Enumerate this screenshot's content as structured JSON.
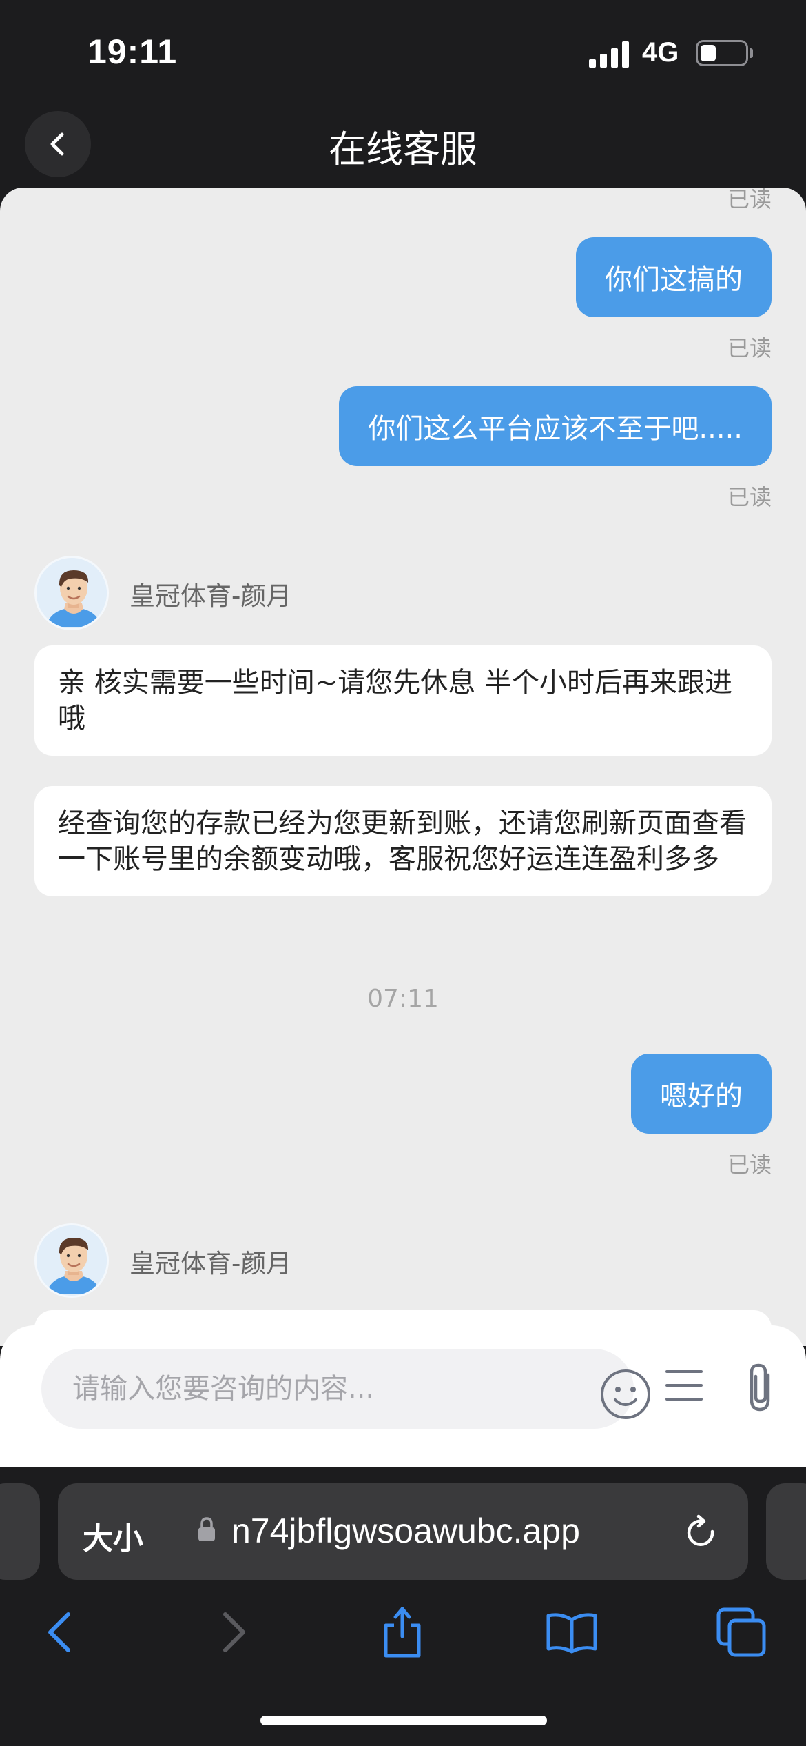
{
  "status_bar": {
    "time": "19:11",
    "network": "4G",
    "battery_level": 0.35
  },
  "nav": {
    "title": "在线客服"
  },
  "messages": {
    "read_label": "已读",
    "out_1": "你们这搞的",
    "out_2": "你们这么平台应该不至于吧.....",
    "agent_name": "皇冠体育-颜月",
    "in_1": "亲 核实需要一些时间~请您先休息 半个小时后再来跟进哦",
    "in_2": "经查询您的存款已经为您更新到账，还请您刷新页面查看一下账号里的余额变动哦，客服祝您好运连连盈利多多",
    "timestamp": "07:11",
    "out_3": "嗯好的"
  },
  "input": {
    "placeholder": "请输入您要咨询的内容..."
  },
  "browser": {
    "text_size_label": "大小",
    "url": "n74jbflgwsoawubc.app"
  },
  "colors": {
    "accent": "#4b9ce8",
    "chat_bg": "#ececec",
    "dark_bg": "#1c1c1e",
    "safari_blue": "#3b8df2"
  }
}
